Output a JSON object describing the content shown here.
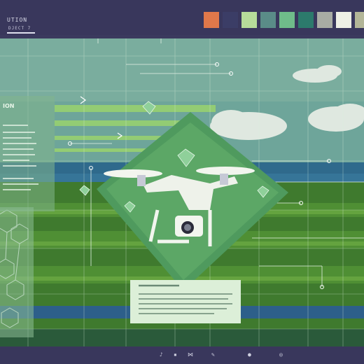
{
  "header": {
    "title": "UTION",
    "subtitle": "DJECT 7"
  },
  "left_panel": {
    "title": "ION"
  },
  "palette": {
    "colors": [
      "#e0784a",
      "#3b3d66",
      "#b6dc9a",
      "#5a8c88",
      "#6fbc8a",
      "#2c7a6c",
      "#a8aca4",
      "#eef0e6",
      "#b3b698"
    ]
  },
  "toolbar": {
    "icons": [
      "music-note-icon",
      "square-icon",
      "bowtie-icon",
      "edit-icon",
      "circle-icon",
      "target-icon"
    ]
  }
}
